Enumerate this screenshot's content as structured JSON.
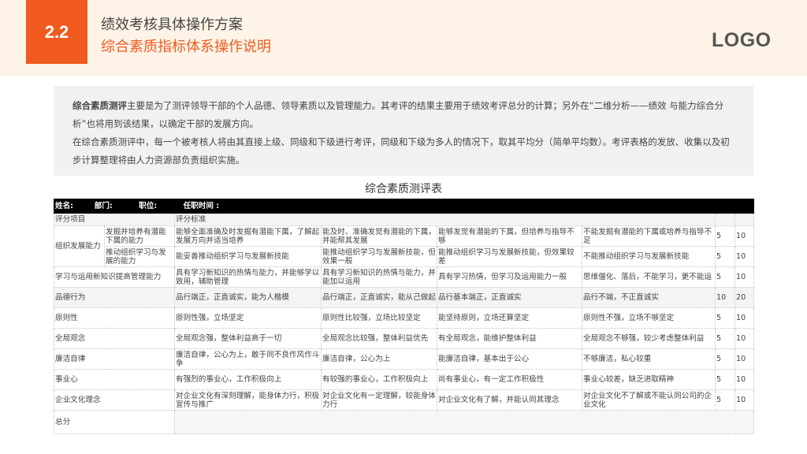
{
  "header": {
    "section_number": "2.2",
    "title": "绩效考核具体操作方案",
    "subtitle": "综合素质指标体系操作说明",
    "logo": "LOGO"
  },
  "intro": {
    "lead": "综合素质测评",
    "line1_rest": "主要是为了测评领导干部的个人品德、领导素质以及管理能力。其考评的结果主要用于绩效考评总分的计算；另外在“二维分析——绩效 与能力综合分析”也将用到该结果，以确定干部的发展方向。",
    "line2": "在综合素质测评中，每一个被考核人将由其直接上级、同级和下级进行考评，同级和下级为多人的情况下，取其平均分（简单平均数）。考评表格的发放、收集以及初步计算整理将由人力资源部负责组织实施。"
  },
  "table": {
    "title": "综合素质测评表",
    "header_line": "姓名:        部门:          职位:          任职时间 :",
    "label_item": "评分项目",
    "label_criteria": "评分标准",
    "rows": [
      {
        "item": "组织发展能力",
        "sub": "发掘并培养有潜能下属的能力",
        "c1": "能够全面准确及时发掘有潜能下属，了解起发展方向并适当培养",
        "c2": "能及时、准确发觉有潜能的下属，并能帮其发展",
        "c3": "能够发觉有潜能的下属，但培养与指导不够",
        "c4": "不能发掘有潜能的下属或培养与指导不足",
        "s1": "5",
        "s2": "10"
      },
      {
        "sub": "推动组织学习与发展的能力",
        "c1": "能妥善推动组织学习与发展新技能",
        "c2": "能推动组织学习与发展新技能，但效果一般",
        "c3": "能推动组织学习与发展新技能，但效果较差",
        "c4": "不能推动组织学习与发展新技能",
        "s1": "5",
        "s2": "10"
      },
      {
        "item": "学习与运用新知识提高管理能力",
        "c1": "具有学习新知识的热情与能力，并能够学以致用，辅助管理",
        "c2": "具有学习新知识的热情与能力，并能加以运用",
        "c3": "具有学习热情，但学习及运用能力一般",
        "c4": "思维僵化、落后，不能学习，更不能运",
        "s1": "5",
        "s2": "10"
      },
      {
        "item": "品德行为",
        "c1": "品行端正，正直诚实，能为人楷模",
        "c2": "品行端正，正直诚实，能从己做起",
        "c3": "品行基本端正，正直诚实",
        "c4": "品行不端，不正直诚实",
        "s1": "10",
        "s2": "20"
      },
      {
        "item": "原则性",
        "c1": "原则性强，立场坚定",
        "c2": "原则性比较强，立场比较坚定",
        "c3": "能坚持原则，立场还算坚定",
        "c4": "原则性不强，立场不够坚定",
        "s1": "5",
        "s2": "10"
      },
      {
        "item": "全局观念",
        "c1": "全局观念强，整体利益高于一切",
        "c2": "全局观念比较强，整体利益优先",
        "c3": "有全局观念，能维护整体利益",
        "c4": "全局观念不够强，较少考虑整体利益",
        "s1": "5",
        "s2": "10"
      },
      {
        "item": "廉洁自律",
        "c1": "廉洁自律，公心为上，敢于同不良作风作斗争",
        "c2": "廉洁自律，公心为上",
        "c3": "能廉洁自律，基本出于公心",
        "c4": "不够廉洁，私心较重",
        "s1": "5",
        "s2": "10"
      },
      {
        "item": "事业心",
        "c1": "有强烈的事业心，工作积极向上",
        "c2": "有较强的事业心，工作积极向上",
        "c3": "尚有事业心，有一定工作积极性",
        "c4": "事业心较差，缺乏进取精神",
        "s1": "5",
        "s2": "10"
      },
      {
        "item": "企业文化理念",
        "c1": "对企业文化有深刻理解，能身体力行，积极宣传与推广",
        "c2": "对企业文化有一定理解，较能身体力行",
        "c3": "对企业文化有了解，并能认同其理念",
        "c4": "对企业文化不了解或不能认同公司的企业文化",
        "s1": "5",
        "s2": "10"
      }
    ],
    "total_label": "总分"
  }
}
